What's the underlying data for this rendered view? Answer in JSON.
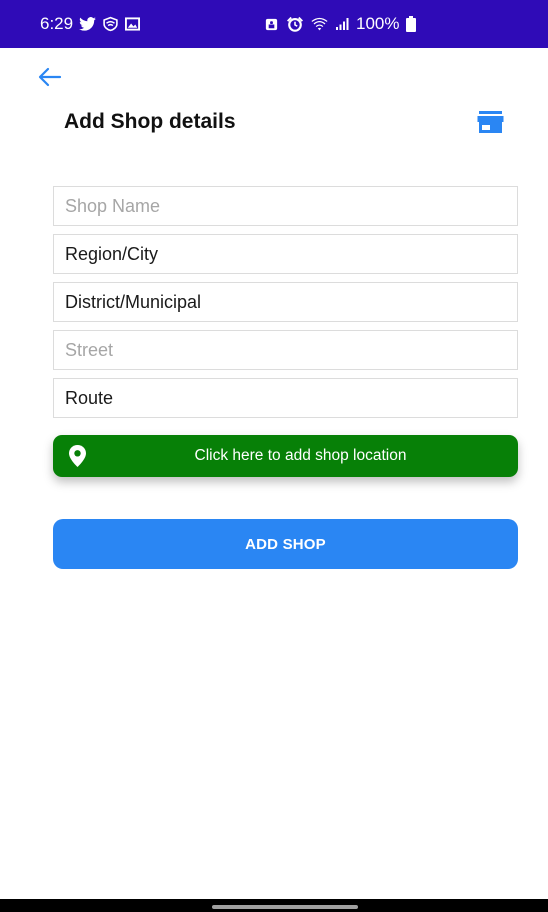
{
  "status_bar": {
    "time": "6:29",
    "battery": "100%",
    "left_icons": [
      "twitter-icon",
      "vpn-shield-icon",
      "gallery-icon"
    ],
    "right_icons": [
      "lock-icon",
      "alarm-icon",
      "wifi-icon",
      "signal-icon",
      "battery-icon"
    ]
  },
  "header": {
    "back_icon": "arrow-left-icon",
    "title": "Add Shop details",
    "store_icon": "storefront-icon"
  },
  "form": {
    "shop_name": {
      "value": "",
      "placeholder": "Shop Name"
    },
    "region": {
      "value": "Region/City",
      "placeholder": ""
    },
    "district": {
      "value": "District/Municipal",
      "placeholder": ""
    },
    "street": {
      "value": "",
      "placeholder": "Street"
    },
    "route": {
      "value": "Route",
      "placeholder": ""
    }
  },
  "location_button": {
    "icon": "map-pin-icon",
    "label": "Click here to add shop location"
  },
  "submit": {
    "label": "ADD SHOP"
  },
  "colors": {
    "status_bar": "#2f0bb7",
    "accent_blue": "#2a86f3",
    "location_green": "#078007"
  }
}
